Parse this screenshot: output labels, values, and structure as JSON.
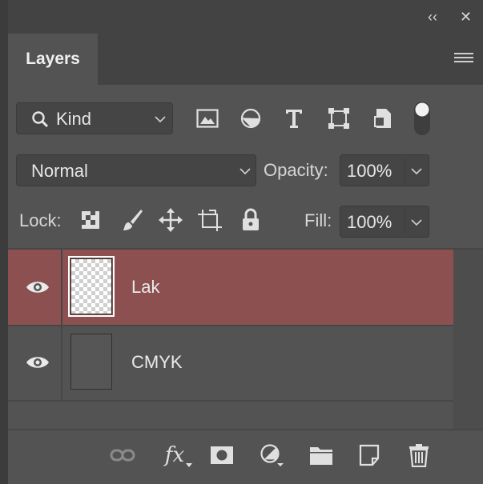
{
  "window": {
    "collapse_label": "‹‹",
    "close_label": "✕"
  },
  "panel": {
    "tab_label": "Layers",
    "menu_icon": "hamburger-menu-icon"
  },
  "filter": {
    "kind_label": "Kind",
    "icons": [
      "image-filter-icon",
      "adjustment-filter-icon",
      "type-filter-icon",
      "shape-filter-icon",
      "smart-object-filter-icon",
      "filter-toggle-icon"
    ]
  },
  "blend": {
    "mode_value": "Normal",
    "opacity_label": "Opacity:",
    "opacity_value": "100%"
  },
  "lock": {
    "label": "Lock:",
    "icons": [
      "lock-transparent-pixels-icon",
      "lock-image-pixels-icon",
      "lock-position-icon",
      "lock-artboard-icon",
      "lock-all-icon"
    ],
    "fill_label": "Fill:",
    "fill_value": "100%"
  },
  "layers": [
    {
      "name": "Lak",
      "visible": true,
      "selected": true,
      "thumbnail": "transparent"
    },
    {
      "name": "CMYK",
      "visible": true,
      "selected": false,
      "thumbnail": "solid-gray"
    }
  ],
  "bottom_icons": [
    "link-layers-icon",
    "fx-icon",
    "add-mask-icon",
    "adjustment-layer-icon",
    "group-folder-icon",
    "new-layer-icon",
    "trash-icon"
  ],
  "bottom_fx_label": "fx",
  "colors": {
    "panel_bg": "#535353",
    "header_bg": "#434343",
    "selected_row": "#8c5050"
  }
}
